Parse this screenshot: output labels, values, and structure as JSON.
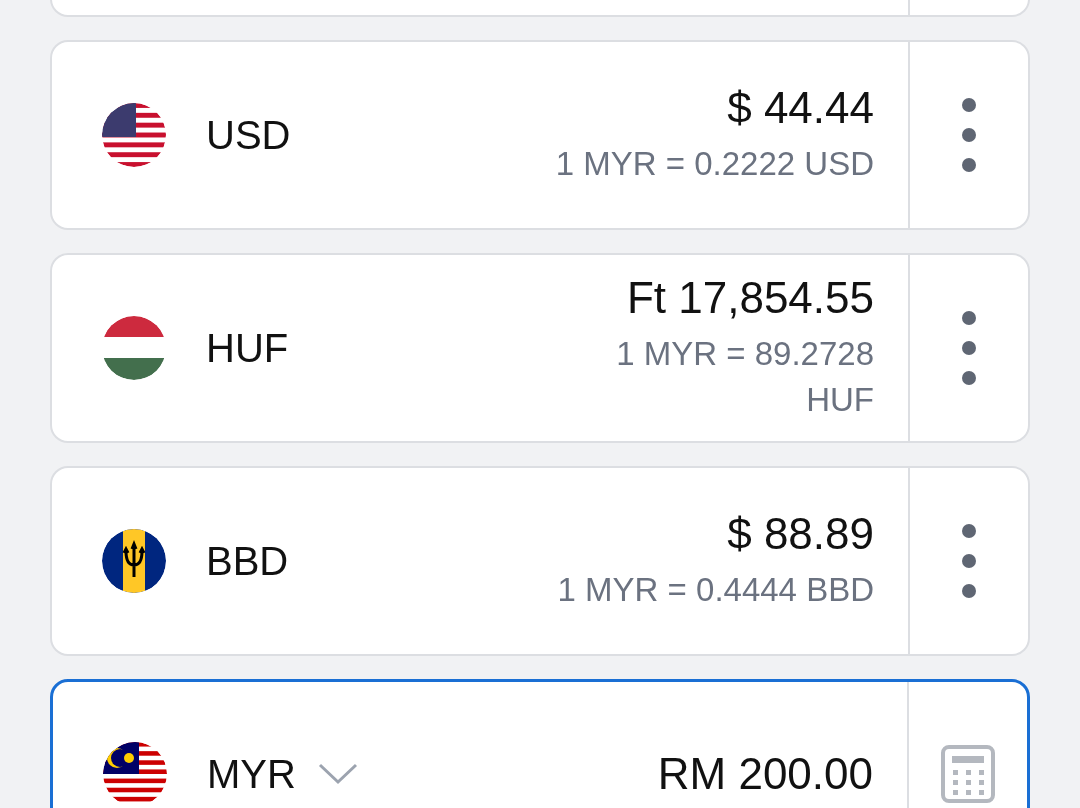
{
  "rows": [
    {
      "code": "USD",
      "kind": "us",
      "amount": "$ 44.44",
      "rate": "1 MYR = 0.2222 USD",
      "selected": false
    },
    {
      "code": "HUF",
      "kind": "hu",
      "amount": "Ft 17,854.55",
      "rate": "1 MYR = 89.2728 HUF",
      "selected": false
    },
    {
      "code": "BBD",
      "kind": "bb",
      "amount": "$ 88.89",
      "rate": "1 MYR = 0.4444 BBD",
      "selected": false
    },
    {
      "code": "MYR",
      "kind": "my",
      "amount": "RM 200.00",
      "selected": true
    }
  ]
}
